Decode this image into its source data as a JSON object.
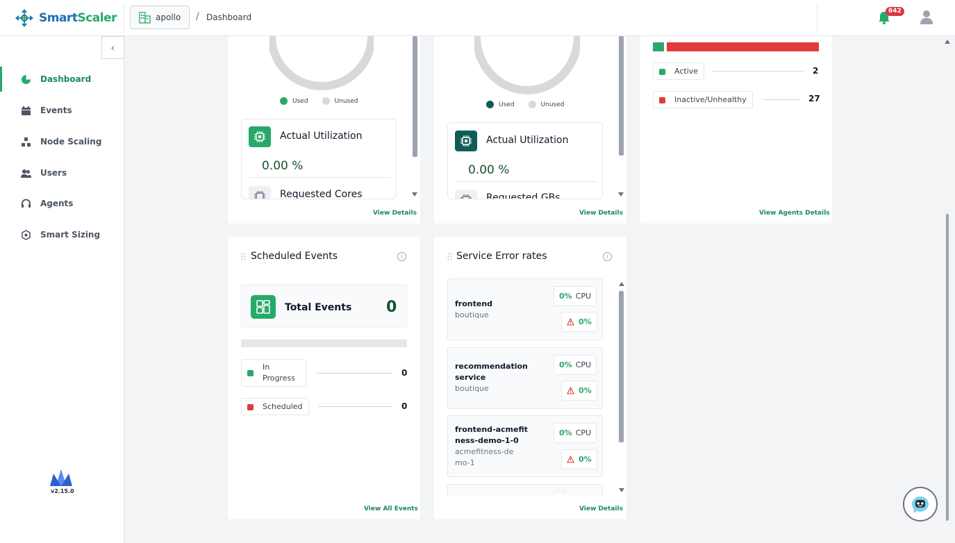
{
  "app": {
    "brand_part1": "Smart",
    "brand_part2": "Scaler",
    "version": "v2.15.0"
  },
  "header": {
    "workspace": "apollo",
    "breadcrumb_separator": "/",
    "breadcrumb_page": "Dashboard",
    "notification_count": "642"
  },
  "sidebar": {
    "items": [
      {
        "label": "Dashboard",
        "icon": "pie-chart-icon",
        "active": true
      },
      {
        "label": "Events",
        "icon": "calendar-icon"
      },
      {
        "label": "Node Scaling",
        "icon": "nodes-icon"
      },
      {
        "label": "Users",
        "icon": "users-icon"
      },
      {
        "label": "Agents",
        "icon": "headset-icon"
      },
      {
        "label": "Smart Sizing",
        "icon": "sizing-icon"
      }
    ]
  },
  "cpu_card": {
    "legend_used": "Used",
    "legend_unused": "Unused",
    "util_title": "Actual Utilization",
    "util_value": "0.00 %",
    "requested_title": "Requested Cores",
    "link": "View Details"
  },
  "memory_card": {
    "legend_used": "Used",
    "legend_unused": "Unused",
    "util_title": "Actual Utilization",
    "util_value": "0.00 %",
    "requested_title": "Requested GBs",
    "link": "View Details"
  },
  "agents_card": {
    "active_label": "Active",
    "active_count": "2",
    "inactive_label": "Inactive/Unhealthy",
    "inactive_count": "27",
    "link": "View Agents Details"
  },
  "events_card": {
    "title": "Scheduled Events",
    "total_label": "Total Events",
    "total_value": "0",
    "in_progress_label": "In Progress",
    "in_progress_count": "0",
    "scheduled_label": "Scheduled",
    "scheduled_count": "0",
    "link": "View All Events"
  },
  "errors_card": {
    "title": "Service Error rates",
    "services": [
      {
        "name": "frontend",
        "namespace": "boutique",
        "cpu_pct": "0%",
        "cpu_label": "CPU",
        "error_pct": "0%"
      },
      {
        "name": "recommendation service",
        "namespace": "boutique",
        "cpu_pct": "0%",
        "cpu_label": "CPU",
        "error_pct": "0%"
      },
      {
        "name": "frontend-acmefit ness-demo-1-0",
        "namespace": "acmefitness-de mo-1",
        "cpu_pct": "0%",
        "cpu_label": "CPU",
        "error_pct": "0%"
      }
    ],
    "link": "View Details"
  },
  "colors": {
    "accent": "#27a96a",
    "danger": "#e03b3b",
    "brand_blue": "#1e6fb5",
    "dark_teal": "#0f5c57"
  }
}
